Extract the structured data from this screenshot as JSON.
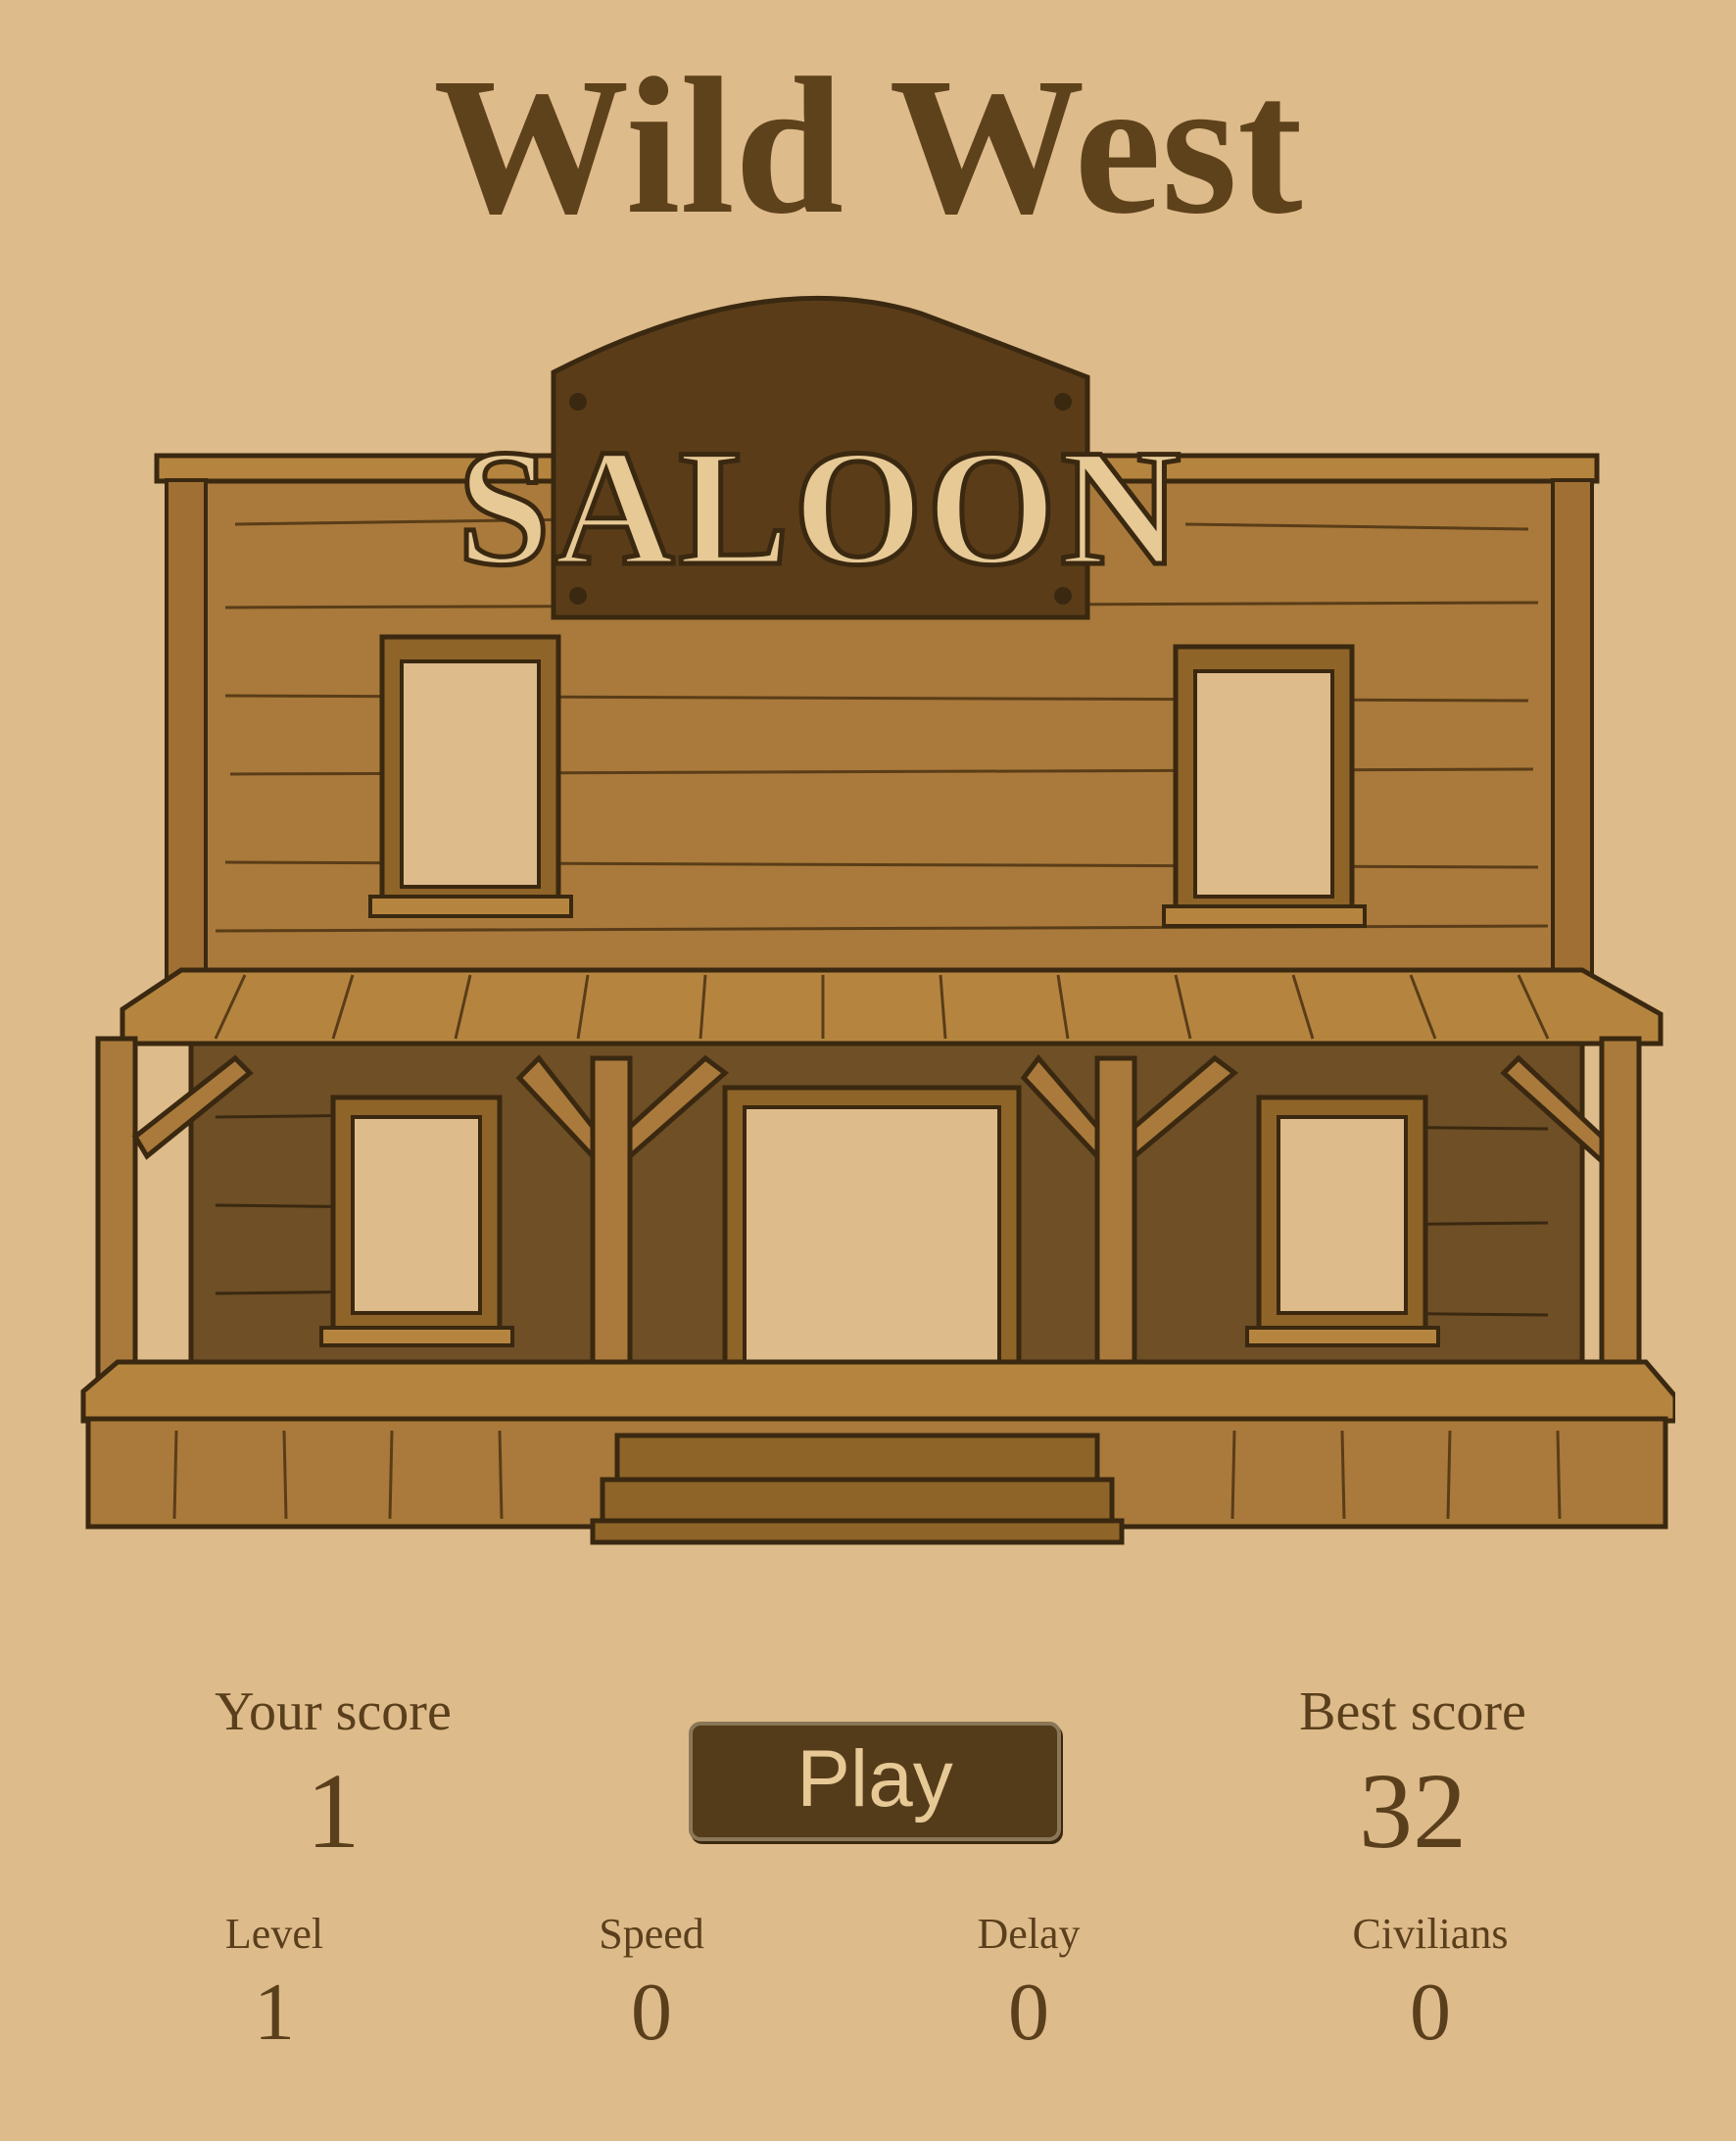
{
  "title": "Wild West",
  "sign_text": "SALOON",
  "score": {
    "your_label": "Your score",
    "your_value": "1",
    "best_label": "Best score",
    "best_value": "32"
  },
  "play_label": "Play",
  "stats": {
    "level_label": "Level",
    "level_value": "1",
    "speed_label": "Speed",
    "speed_value": "0",
    "delay_label": "Delay",
    "delay_value": "0",
    "civilians_label": "Civilians",
    "civilians_value": "0"
  },
  "colors": {
    "background": "#debb8a",
    "wood": "#a97a3b",
    "dark_wood": "#6e4f26",
    "outline": "#3a2810",
    "button": "#543c1b"
  }
}
